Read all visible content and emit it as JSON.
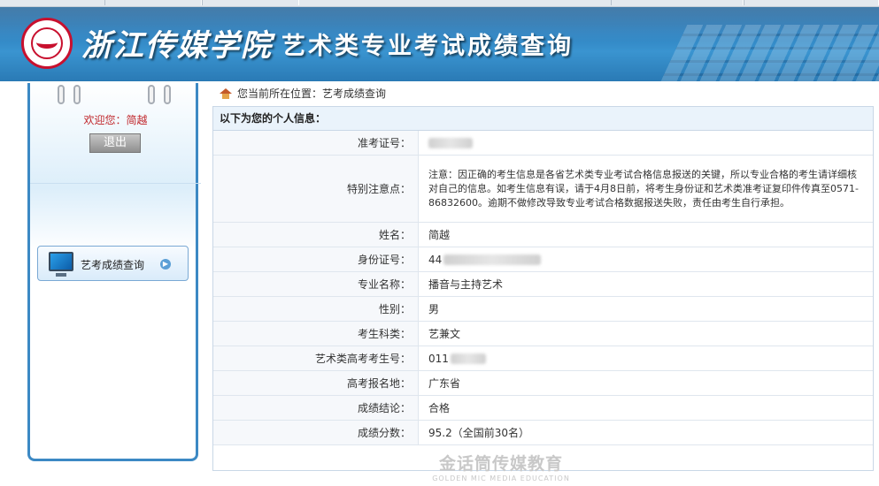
{
  "header": {
    "school_name": "浙江传媒学院",
    "system_title": "艺术类专业考试成绩查询"
  },
  "sidebar": {
    "welcome_text": "欢迎您：简越",
    "logout_label": "退出",
    "menu_item_label": "艺考成绩查询"
  },
  "breadcrumb": {
    "text": "您当前所在位置：艺考成绩查询"
  },
  "info": {
    "section_title": "以下为您的个人信息：",
    "rows": [
      {
        "label": "准考证号：",
        "value": ""
      },
      {
        "label": "特别注意点：",
        "value": "注意：因正确的考生信息是各省艺术类专业考试合格信息报送的关键，所以专业合格的考生请详细核对自己的信息。如考生信息有误，请于4月8日前，将考生身份证和艺术类准考证复印件传真至0571- 86832600。逾期不做修改导致专业考试合格数据报送失败，责任由考生自行承担。"
      },
      {
        "label": "姓名：",
        "value": "简越"
      },
      {
        "label": "身份证号：",
        "value": "44"
      },
      {
        "label": "专业名称：",
        "value": "播音与主持艺术"
      },
      {
        "label": "性别：",
        "value": "男"
      },
      {
        "label": "考生科类：",
        "value": "艺兼文"
      },
      {
        "label": "艺术类高考考生号：",
        "value": "011"
      },
      {
        "label": "高考报名地：",
        "value": "广东省"
      },
      {
        "label": "成绩结论：",
        "value": "合格"
      },
      {
        "label": "成绩分数：",
        "value": "95.2（全国前30名）"
      }
    ]
  },
  "watermark": {
    "title": "金话筒传媒教育",
    "subtitle": "GOLDEN MIC MEDIA EDUCATION"
  },
  "colors": {
    "banner": "#2e82c0",
    "sidebar_border": "#3c89c4",
    "welcome": "#c0262b"
  }
}
